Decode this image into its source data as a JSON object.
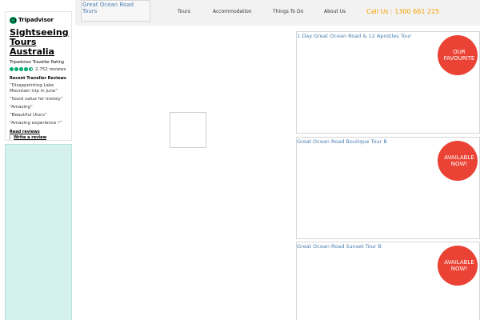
{
  "tripadvisor": {
    "logo_text": "Tripadvisor",
    "title": "Sightseeing Tours Australia",
    "rating_label": "Tripadvisor Traveller Rating",
    "rating": 4.5,
    "review_count": "2,752 reviews",
    "recent_label": "Recent Traveller Reviews",
    "reviews": [
      "“Disappointing Lake Mountain trip in june”",
      "“Good value for money”",
      "“Amazing”",
      "“Beautiful Uluru”",
      "“Amazing experience !”"
    ],
    "read_reviews": "Read reviews",
    "write_review": "Write a review"
  },
  "header": {
    "logo_alt": "Great Ocean Road Tours",
    "nav": [
      "Tours",
      "Accommodation",
      "Things To Do",
      "About Us"
    ],
    "phone": "Call Us : 1300 661 225",
    "phone_color": "#f7a200"
  },
  "tours": [
    {
      "title": "1 Day Great Ocean Road & 12 Apostles Tour",
      "badge": "OUR FAVOURITE"
    },
    {
      "title": "Great Ocean Road Boutique Tour B",
      "badge": "AVAILABLE NOW!"
    },
    {
      "title": "Great Ocean Road Sunset Tour B",
      "badge": "AVAILABLE NOW!"
    }
  ],
  "colors": {
    "accent_green": "#00aa6c",
    "badge_red": "#ea4335",
    "link_blue": "#4a7fb0",
    "teal_panel": "#d4f1ed"
  }
}
